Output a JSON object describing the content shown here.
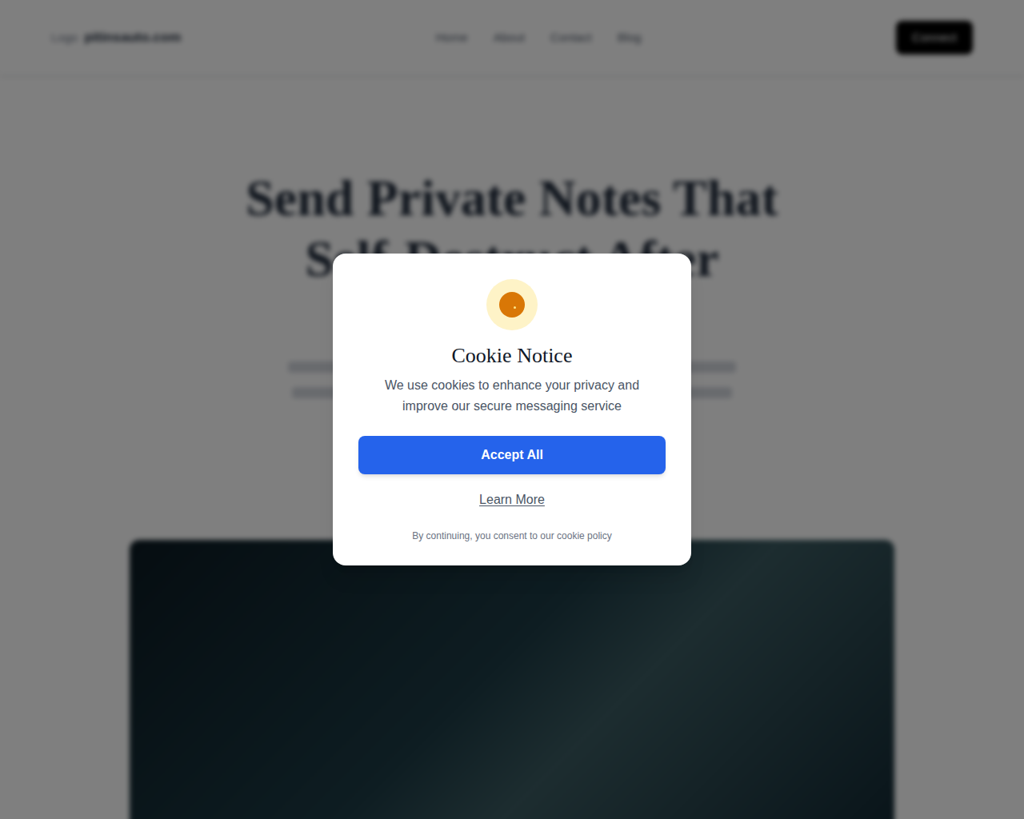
{
  "header": {
    "logo_prefix": "Logo",
    "logo": "pitinsauto.com",
    "nav": [
      "Home",
      "About",
      "Contact",
      "Blog"
    ],
    "cta": "Connect"
  },
  "hero": {
    "title": "Send Private Notes That Self-Destruct After"
  },
  "cookie_modal": {
    "title": "Cookie Notice",
    "message": "We use cookies to enhance your privacy and improve our secure messaging service",
    "accept": "Accept All",
    "learn_more": "Learn More",
    "footnote": "By continuing, you consent to our cookie policy"
  }
}
